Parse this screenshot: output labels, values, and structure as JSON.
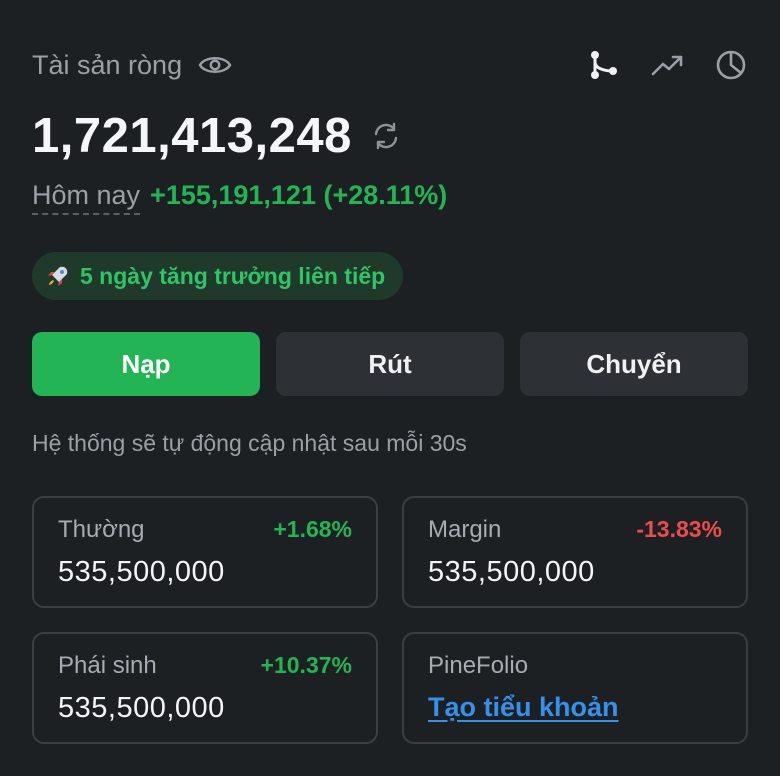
{
  "header": {
    "net_label": "Tài sản ròng",
    "icons": [
      "eye-icon",
      "branch-icon",
      "trend-up-icon",
      "pie-chart-icon"
    ]
  },
  "balance": {
    "value": "1,721,413,248",
    "refresh_icon": "refresh-icon"
  },
  "today": {
    "label": "Hôm nay",
    "change": "+155,191,121 (+28.11%)"
  },
  "streak": {
    "icon": "rocket-icon",
    "text": "5 ngày tăng trưởng liên tiếp"
  },
  "actions": {
    "deposit": "Nạp",
    "withdraw": "Rút",
    "transfer": "Chuyển"
  },
  "auto_note": "Hệ thống sẽ tự động cập nhật sau mỗi 30s",
  "accounts": [
    {
      "label": "Thường",
      "pct": "+1.68%",
      "value": "535,500,000"
    },
    {
      "label": "Margin",
      "pct": "-13.83%",
      "value": "535,500,000"
    },
    {
      "label": "Phái sinh",
      "pct": "+10.37%",
      "value": "535,500,000"
    },
    {
      "label": "PineFolio",
      "link": "Tạo tiểu khoản"
    }
  ],
  "colors": {
    "background": "#1d2023",
    "accent_green": "#22b455",
    "negative_red": "#ea4d4d",
    "link_blue": "#3591ea"
  }
}
